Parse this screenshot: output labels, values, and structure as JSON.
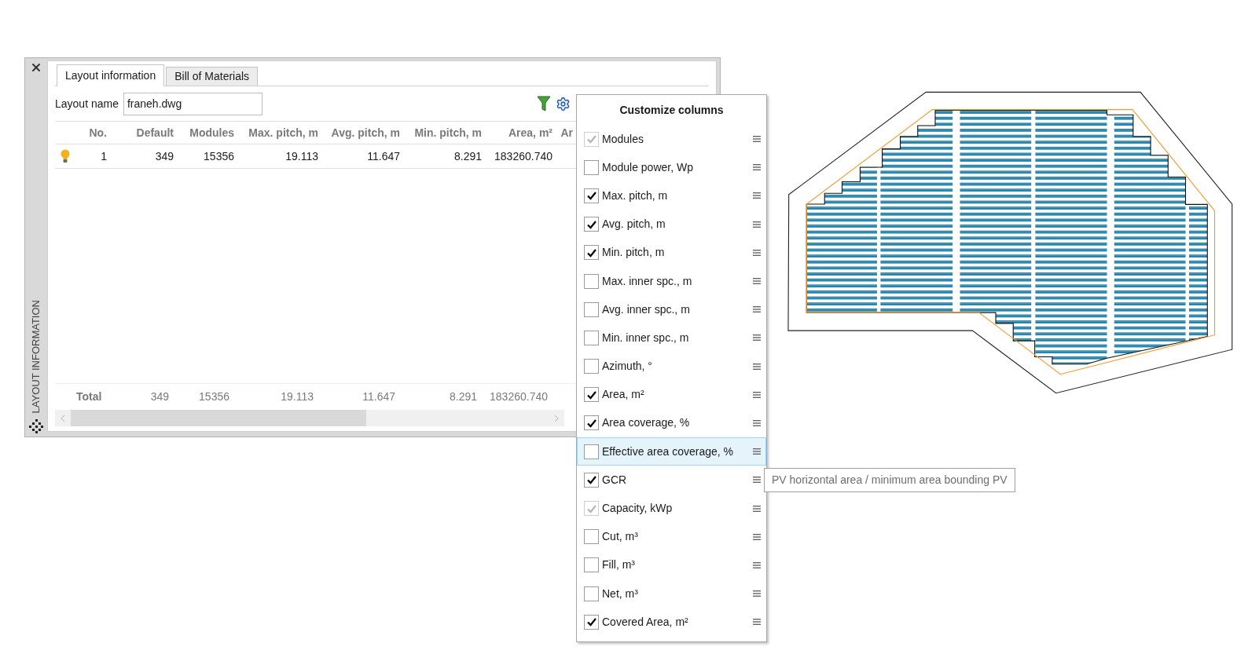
{
  "window": {
    "sidebar_title": "LAYOUT INFORMATION"
  },
  "tabs": [
    {
      "label": "Layout information",
      "selected": true
    },
    {
      "label": "Bill of Materials",
      "selected": false
    }
  ],
  "layout_name": {
    "label": "Layout name",
    "value": "franeh.dwg"
  },
  "table": {
    "columns": [
      "No.",
      "Default",
      "Modules",
      "Max. pitch, m",
      "Avg. pitch, m",
      "Min. pitch, m",
      "Area, m²",
      "Ar"
    ],
    "rows": [
      {
        "cells": [
          "1",
          "349",
          "15356",
          "19.113",
          "11.647",
          "8.291",
          "183260.740"
        ]
      }
    ],
    "total": {
      "label": "Total",
      "cells": [
        "349",
        "15356",
        "19.113",
        "11.647",
        "8.291",
        "183260.740"
      ]
    }
  },
  "customize": {
    "title": "Customize columns",
    "items": [
      {
        "label": "Modules",
        "checked": true,
        "disabled": true,
        "highlighted": false
      },
      {
        "label": "Module power, Wp",
        "checked": false,
        "disabled": false,
        "highlighted": false
      },
      {
        "label": "Max. pitch, m",
        "checked": true,
        "disabled": false,
        "highlighted": false
      },
      {
        "label": "Avg. pitch, m",
        "checked": true,
        "disabled": false,
        "highlighted": false
      },
      {
        "label": "Min. pitch, m",
        "checked": true,
        "disabled": false,
        "highlighted": false
      },
      {
        "label": "Max. inner spc., m",
        "checked": false,
        "disabled": false,
        "highlighted": false
      },
      {
        "label": "Avg. inner spc., m",
        "checked": false,
        "disabled": false,
        "highlighted": false
      },
      {
        "label": "Min. inner spc., m",
        "checked": false,
        "disabled": false,
        "highlighted": false
      },
      {
        "label": "Azimuth, °",
        "checked": false,
        "disabled": false,
        "highlighted": false
      },
      {
        "label": "Area, m²",
        "checked": true,
        "disabled": false,
        "highlighted": false
      },
      {
        "label": "Area coverage, %",
        "checked": true,
        "disabled": false,
        "highlighted": false
      },
      {
        "label": "Effective area coverage, %",
        "checked": false,
        "disabled": false,
        "highlighted": true
      },
      {
        "label": "GCR",
        "checked": true,
        "disabled": false,
        "highlighted": false
      },
      {
        "label": "Capacity, kWp",
        "checked": true,
        "disabled": true,
        "highlighted": false
      },
      {
        "label": "Cut, m³",
        "checked": false,
        "disabled": false,
        "highlighted": false
      },
      {
        "label": "Fill, m³",
        "checked": false,
        "disabled": false,
        "highlighted": false
      },
      {
        "label": "Net, m³",
        "checked": false,
        "disabled": false,
        "highlighted": false
      },
      {
        "label": "Covered Area, m²",
        "checked": true,
        "disabled": false,
        "highlighted": false
      }
    ]
  },
  "tooltip": "PV horizontal area / minimum area bounding PV"
}
